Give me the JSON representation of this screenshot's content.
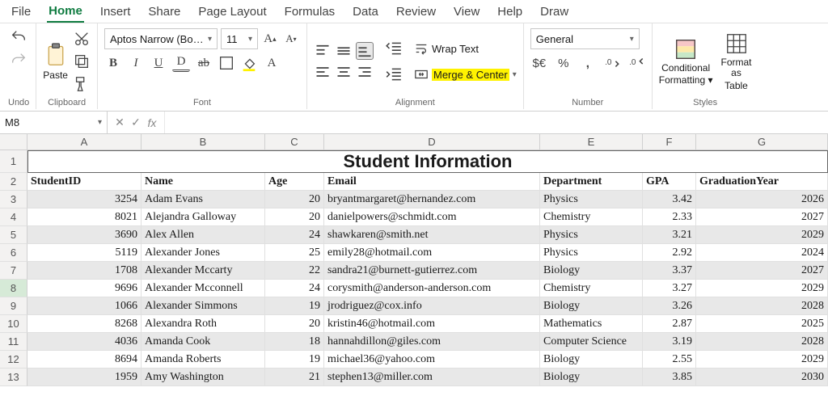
{
  "menu": [
    "File",
    "Home",
    "Insert",
    "Share",
    "Page Layout",
    "Formulas",
    "Data",
    "Review",
    "View",
    "Help",
    "Draw"
  ],
  "active_menu": "Home",
  "ribbon": {
    "undo_label": "Undo",
    "clipboard_label": "Clipboard",
    "paste_label": "Paste",
    "font_label": "Font",
    "font_name": "Aptos Narrow (Bo…",
    "font_size": "11",
    "alignment_label": "Alignment",
    "wrap_text": "Wrap Text",
    "merge_center": "Merge & Center",
    "number_label": "Number",
    "number_format": "General",
    "styles_label": "Styles",
    "cond_fmt_l1": "Conditional",
    "cond_fmt_l2": "Formatting",
    "fmt_tab_l1": "Format as",
    "fmt_tab_l2": "Table"
  },
  "namebox": "M8",
  "formula": "",
  "columns": [
    "A",
    "B",
    "C",
    "D",
    "E",
    "F",
    "G"
  ],
  "title": "Student Information",
  "headers": {
    "student_id": "StudentID",
    "name": "Name",
    "age": "Age",
    "email": "Email",
    "department": "Department",
    "gpa": "GPA",
    "graduation_year": "GraduationYear"
  },
  "rows": [
    {
      "n": 3,
      "id": "3254",
      "name": "Adam Evans",
      "age": "20",
      "email": "bryantmargaret@hernandez.com",
      "dept": "Physics",
      "gpa": "3.42",
      "year": "2026"
    },
    {
      "n": 4,
      "id": "8021",
      "name": "Alejandra Galloway",
      "age": "20",
      "email": "danielpowers@schmidt.com",
      "dept": "Chemistry",
      "gpa": "2.33",
      "year": "2027"
    },
    {
      "n": 5,
      "id": "3690",
      "name": "Alex Allen",
      "age": "24",
      "email": "shawkaren@smith.net",
      "dept": "Physics",
      "gpa": "3.21",
      "year": "2029"
    },
    {
      "n": 6,
      "id": "5119",
      "name": "Alexander Jones",
      "age": "25",
      "email": "emily28@hotmail.com",
      "dept": "Physics",
      "gpa": "2.92",
      "year": "2024"
    },
    {
      "n": 7,
      "id": "1708",
      "name": "Alexander Mccarty",
      "age": "22",
      "email": "sandra21@burnett-gutierrez.com",
      "dept": "Biology",
      "gpa": "3.37",
      "year": "2027"
    },
    {
      "n": 8,
      "id": "9696",
      "name": "Alexander Mcconnell",
      "age": "24",
      "email": "corysmith@anderson-anderson.com",
      "dept": "Chemistry",
      "gpa": "3.27",
      "year": "2029"
    },
    {
      "n": 9,
      "id": "1066",
      "name": "Alexander Simmons",
      "age": "19",
      "email": "jrodriguez@cox.info",
      "dept": "Biology",
      "gpa": "3.26",
      "year": "2028"
    },
    {
      "n": 10,
      "id": "8268",
      "name": "Alexandra Roth",
      "age": "20",
      "email": "kristin46@hotmail.com",
      "dept": "Mathematics",
      "gpa": "2.87",
      "year": "2025"
    },
    {
      "n": 11,
      "id": "4036",
      "name": "Amanda Cook",
      "age": "18",
      "email": "hannahdillon@giles.com",
      "dept": "Computer Science",
      "gpa": "3.19",
      "year": "2028"
    },
    {
      "n": 12,
      "id": "8694",
      "name": "Amanda Roberts",
      "age": "19",
      "email": "michael36@yahoo.com",
      "dept": "Biology",
      "gpa": "2.55",
      "year": "2029"
    },
    {
      "n": 13,
      "id": "1959",
      "name": "Amy Washington",
      "age": "21",
      "email": "stephen13@miller.com",
      "dept": "Biology",
      "gpa": "3.85",
      "year": "2030"
    }
  ],
  "chart_data": {
    "type": "table",
    "title": "Student Information",
    "columns": [
      "StudentID",
      "Name",
      "Age",
      "Email",
      "Department",
      "GPA",
      "GraduationYear"
    ],
    "rows": [
      [
        3254,
        "Adam Evans",
        20,
        "bryantmargaret@hernandez.com",
        "Physics",
        3.42,
        2026
      ],
      [
        8021,
        "Alejandra Galloway",
        20,
        "danielpowers@schmidt.com",
        "Chemistry",
        2.33,
        2027
      ],
      [
        3690,
        "Alex Allen",
        24,
        "shawkaren@smith.net",
        "Physics",
        3.21,
        2029
      ],
      [
        5119,
        "Alexander Jones",
        25,
        "emily28@hotmail.com",
        "Physics",
        2.92,
        2024
      ],
      [
        1708,
        "Alexander Mccarty",
        22,
        "sandra21@burnett-gutierrez.com",
        "Biology",
        3.37,
        2027
      ],
      [
        9696,
        "Alexander Mcconnell",
        24,
        "corysmith@anderson-anderson.com",
        "Chemistry",
        3.27,
        2029
      ],
      [
        1066,
        "Alexander Simmons",
        19,
        "jrodriguez@cox.info",
        "Biology",
        3.26,
        2028
      ],
      [
        8268,
        "Alexandra Roth",
        20,
        "kristin46@hotmail.com",
        "Mathematics",
        2.87,
        2025
      ],
      [
        4036,
        "Amanda Cook",
        18,
        "hannahdillon@giles.com",
        "Computer Science",
        3.19,
        2028
      ],
      [
        8694,
        "Amanda Roberts",
        19,
        "michael36@yahoo.com",
        "Biology",
        2.55,
        2029
      ],
      [
        1959,
        "Amy Washington",
        21,
        "stephen13@miller.com",
        "Biology",
        3.85,
        2030
      ]
    ]
  }
}
